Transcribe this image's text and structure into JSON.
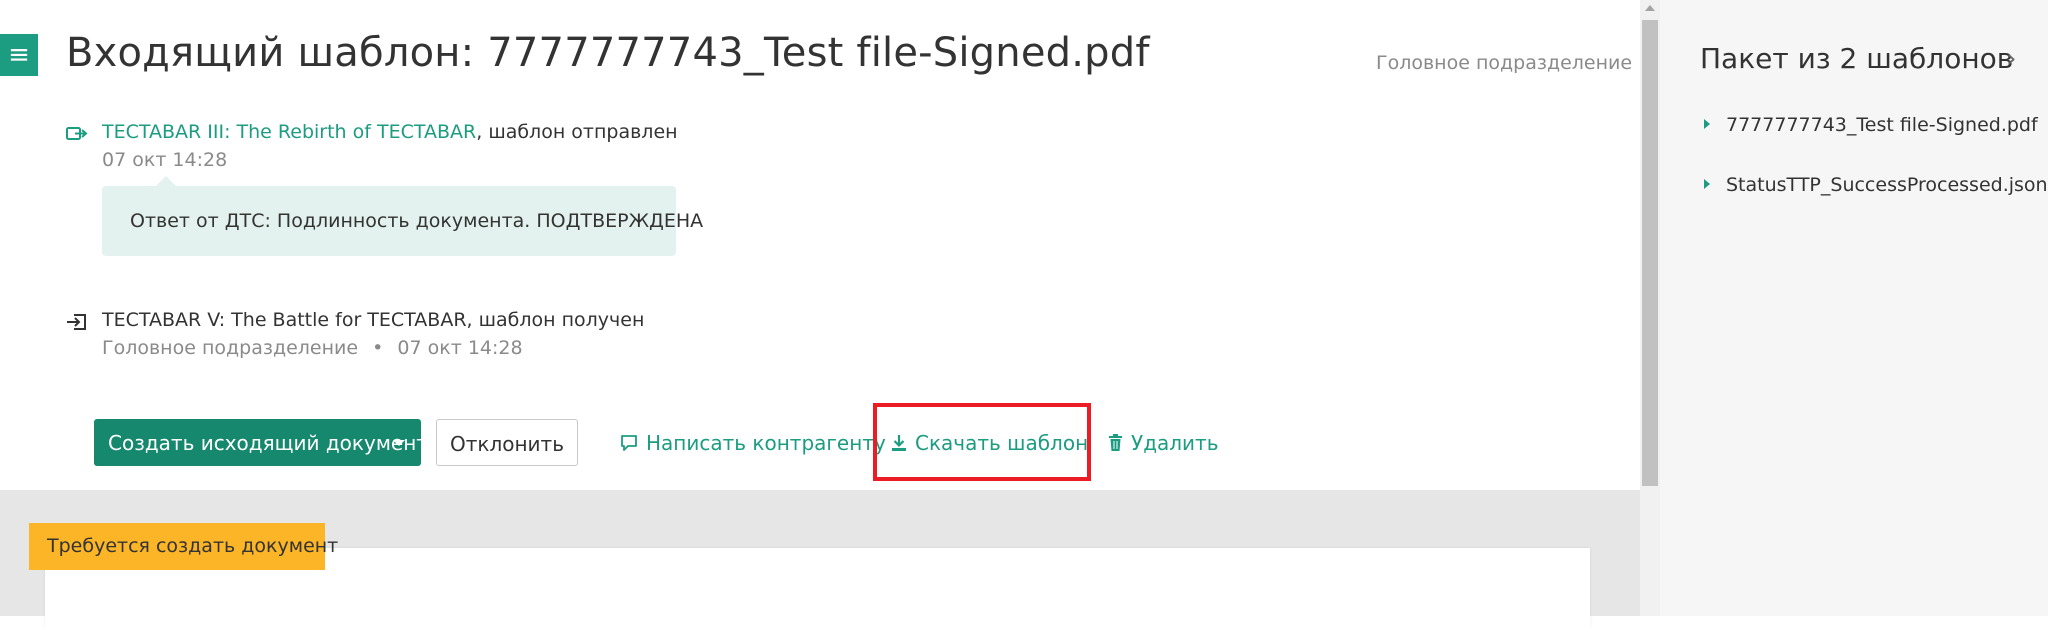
{
  "header": {
    "menu_icon": "hamburger-menu-icon",
    "title": "Входящий шаблон: 7777777743_Test file-Signed.pdf",
    "department": "Головное подразделение"
  },
  "events": [
    {
      "icon": "sent-icon",
      "sender": "TECTABAR III: The Rebirth of TECTABAR",
      "status": ", шаблон отправлен",
      "time": "07 окт 14:28",
      "message": "Ответ от ДТС: Подлинность документа. ПОДТВЕРЖДЕНА"
    },
    {
      "icon": "received-icon",
      "sender": "TECTABAR V: The Battle for TECTABAR",
      "status": ", шаблон получен",
      "department": "Головное подразделение",
      "separator": "•",
      "time": "07 окт 14:28"
    }
  ],
  "actions": {
    "create_outgoing": "Создать исходящий документ",
    "reject": "Отклонить",
    "write_counterparty": "Написать контрагенту",
    "download_template": "Скачать шаблон",
    "delete": "Удалить"
  },
  "document": {
    "ribbon": "Требуется создать документ"
  },
  "sidebar": {
    "title": "Пакет из 2 шаблонов",
    "chevron": "›",
    "items": [
      {
        "label": "7777777743_Test file-Signed.pdf"
      },
      {
        "label": "StatusTTP_SuccessProcessed.json"
      }
    ]
  },
  "colors": {
    "accent": "#1c9c80",
    "primary_button": "#15886d",
    "ribbon": "#fbb526",
    "highlight": "#ec1c24",
    "bubble": "#e3f2ee"
  }
}
